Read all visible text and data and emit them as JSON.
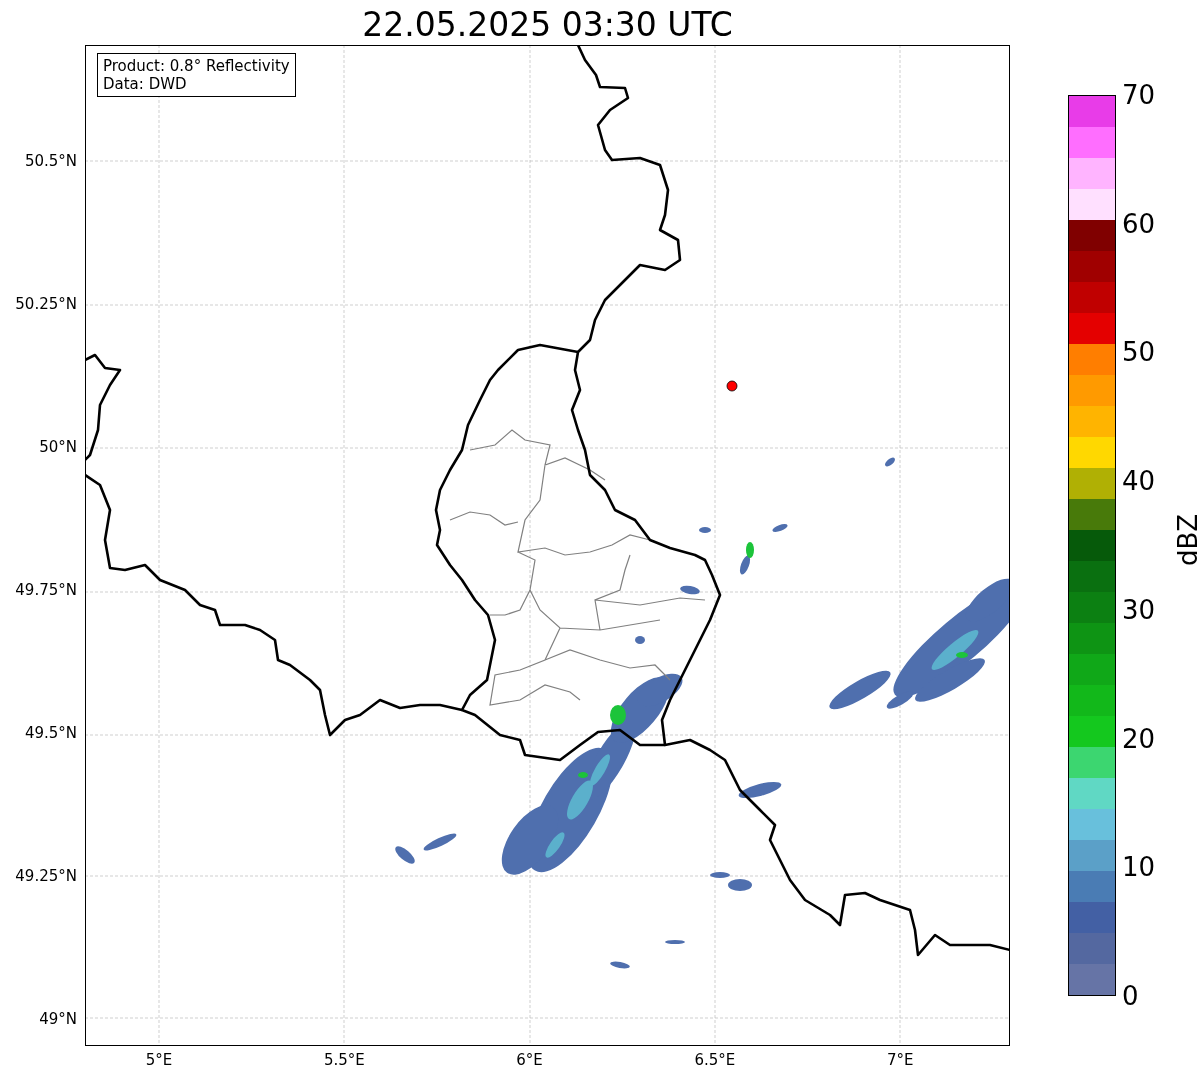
{
  "title": "22.05.2025 03:30 UTC",
  "info": [
    "Product: 0.8° Reflectivity",
    "Data: DWD"
  ],
  "map": {
    "kind": "map",
    "yticks": [
      "50.5°N",
      "50.25°N",
      "50°N",
      "49.75°N",
      "49.5°N",
      "49.25°N",
      "49°N"
    ],
    "xticks": [
      "5°E",
      "5.5°E",
      "6°E",
      "6.5°E",
      "7°E"
    ]
  },
  "colorbar": {
    "label": "dBZ",
    "ticks": [
      "70",
      "60",
      "50",
      "40",
      "30",
      "20",
      "10",
      "0"
    ],
    "bands": [
      {
        "color": "#6674a6"
      },
      {
        "color": "#5468a0"
      },
      {
        "color": "#4360a4"
      },
      {
        "color": "#4a7cb4"
      },
      {
        "color": "#5ba0c8"
      },
      {
        "color": "#68c0dc"
      },
      {
        "color": "#60d8c4"
      },
      {
        "color": "#3cd670"
      },
      {
        "color": "#14c81e"
      },
      {
        "color": "#12b81a"
      },
      {
        "color": "#10a818"
      },
      {
        "color": "#0e9414"
      },
      {
        "color": "#0c8012"
      },
      {
        "color": "#0a7010"
      },
      {
        "color": "#065a0a"
      },
      {
        "color": "#487a0a"
      },
      {
        "color": "#b0b004"
      },
      {
        "color": "#ffd800"
      },
      {
        "color": "#ffb400"
      },
      {
        "color": "#ff9a00"
      },
      {
        "color": "#ff7e00"
      },
      {
        "color": "#e40000"
      },
      {
        "color": "#c00000"
      },
      {
        "color": "#a00000"
      },
      {
        "color": "#800000"
      },
      {
        "color": "#ffe0ff"
      },
      {
        "color": "#ffb4ff"
      },
      {
        "color": "#ff6eff"
      },
      {
        "color": "#e83ce8"
      }
    ]
  }
}
